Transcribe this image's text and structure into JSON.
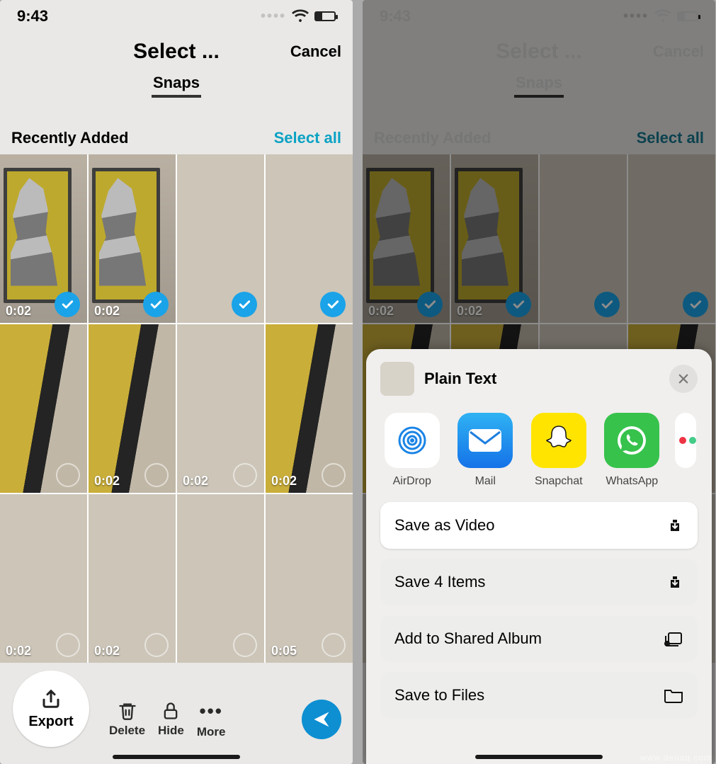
{
  "status": {
    "time": "9:43"
  },
  "header": {
    "title": "Select ...",
    "cancel": "Cancel",
    "tab": "Snaps"
  },
  "section": {
    "label": "Recently Added",
    "select_all": "Select all"
  },
  "grid": {
    "rows": [
      [
        {
          "duration": "0:02",
          "selected": true,
          "kind": "portrait"
        },
        {
          "duration": "0:02",
          "selected": true,
          "kind": "portrait"
        },
        {
          "duration": "",
          "selected": true,
          "kind": "beige"
        },
        {
          "duration": "",
          "selected": true,
          "kind": "beige"
        }
      ],
      [
        {
          "duration": "",
          "selected": false,
          "kind": "wall"
        },
        {
          "duration": "0:02",
          "selected": false,
          "kind": "wall"
        },
        {
          "duration": "0:02",
          "selected": false,
          "kind": "beige"
        },
        {
          "duration": "0:02",
          "selected": false,
          "kind": "wall"
        }
      ],
      [
        {
          "duration": "0:02",
          "selected": false,
          "kind": "beige"
        },
        {
          "duration": "0:02",
          "selected": false,
          "kind": "beige"
        },
        {
          "duration": "",
          "selected": false,
          "kind": "beige"
        },
        {
          "duration": "0:05",
          "selected": false,
          "kind": "beige"
        }
      ]
    ]
  },
  "toolbar": {
    "export_label": "Export",
    "delete_label": "Delete",
    "hide_label": "Hide",
    "more_label": "More"
  },
  "share": {
    "title": "Plain Text",
    "apps": [
      {
        "name": "AirDrop",
        "style": "air"
      },
      {
        "name": "Mail",
        "style": "mail"
      },
      {
        "name": "Snapchat",
        "style": "snap"
      },
      {
        "name": "WhatsApp",
        "style": "wa"
      }
    ],
    "actions": {
      "save_video": "Save as Video",
      "save_items": "Save 4 Items",
      "shared_album": "Add to Shared Album",
      "save_files": "Save to Files"
    }
  },
  "watermark": "www.deuaq.com"
}
